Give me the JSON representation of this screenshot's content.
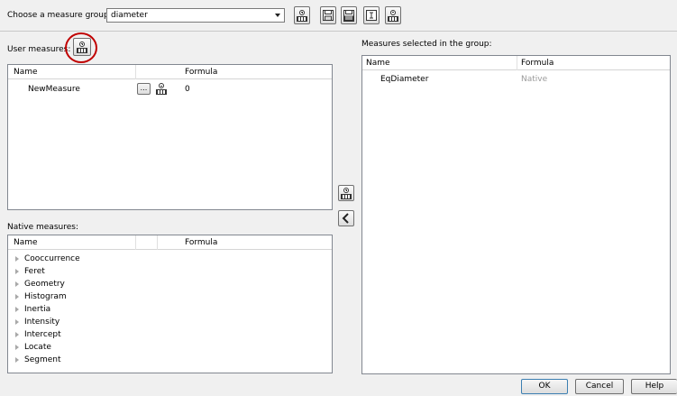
{
  "toolbar": {
    "label": "Choose a measure group:",
    "combo_value": "diameter",
    "buttons": [
      {
        "name": "add-group-button",
        "icon": "add-measure-icon"
      },
      {
        "name": "save-group-button",
        "icon": "save-icon"
      },
      {
        "name": "save-as-group-button",
        "icon": "save-as-icon"
      },
      {
        "name": "rename-group-button",
        "icon": "text-cursor-icon"
      },
      {
        "name": "delete-group-button",
        "icon": "remove-measure-icon"
      }
    ]
  },
  "user_measures": {
    "label": "User measures:",
    "header_name": "Name",
    "header_formula": "Formula",
    "rows": [
      {
        "name": "NewMeasure",
        "edit": "...",
        "formula": "0"
      }
    ]
  },
  "native_measures": {
    "label": "Native measures:",
    "header_name": "Name",
    "header_formula": "Formula",
    "items": [
      "Cooccurrence",
      "Feret",
      "Geometry",
      "Histogram",
      "Inertia",
      "Intensity",
      "Intercept",
      "Locate",
      "Segment"
    ]
  },
  "selected": {
    "label": "Measures selected in the group:",
    "header_name": "Name",
    "header_formula": "Formula",
    "rows": [
      {
        "name": "EqDiameter",
        "formula": "Native"
      }
    ]
  },
  "buttons": {
    "ok": "OK",
    "cancel": "Cancel",
    "help": "Help"
  },
  "colors": {
    "highlight": "#c00000",
    "native_formula_text": "#9a9a9a"
  }
}
